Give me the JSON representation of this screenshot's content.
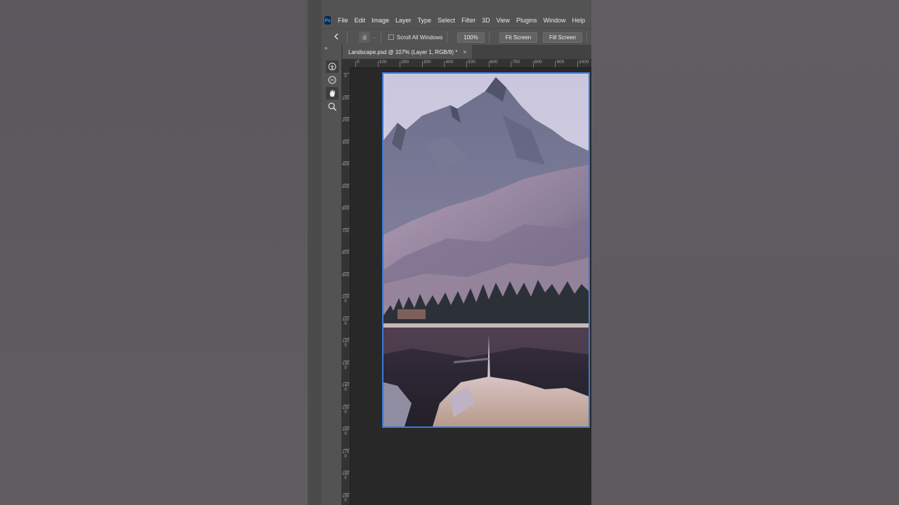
{
  "app": {
    "logo_text": "Ps"
  },
  "menu": [
    "File",
    "Edit",
    "Image",
    "Layer",
    "Type",
    "Select",
    "Filter",
    "3D",
    "View",
    "Plugins",
    "Window",
    "Help"
  ],
  "options": {
    "scroll_all_windows": "Scroll All Windows",
    "zoom_value": "100%",
    "fit_screen": "Fit Screen",
    "fill_screen": "Fill Screen"
  },
  "document": {
    "tab_title": "Landscape.psd @ 107% (Layer 1, RGB/8) *",
    "close_glyph": "×"
  },
  "rulers": {
    "horizontal": [
      "0",
      "100",
      "200",
      "300",
      "400",
      "500",
      "600",
      "700",
      "800",
      "900",
      "1000"
    ],
    "vertical": [
      "0",
      "100",
      "200",
      "300",
      "400",
      "500",
      "600",
      "700",
      "800",
      "900",
      "1000",
      "1100",
      "1200",
      "1300",
      "1400",
      "1500",
      "1600",
      "1700",
      "1800",
      "1900"
    ]
  },
  "tools": [
    "zoom-in-icon",
    "zoom-out-icon",
    "hand-icon",
    "zoom-icon"
  ],
  "colors": {
    "selection_border": "#3d7ad6",
    "panel": "#535353",
    "workspace": "#282828"
  }
}
